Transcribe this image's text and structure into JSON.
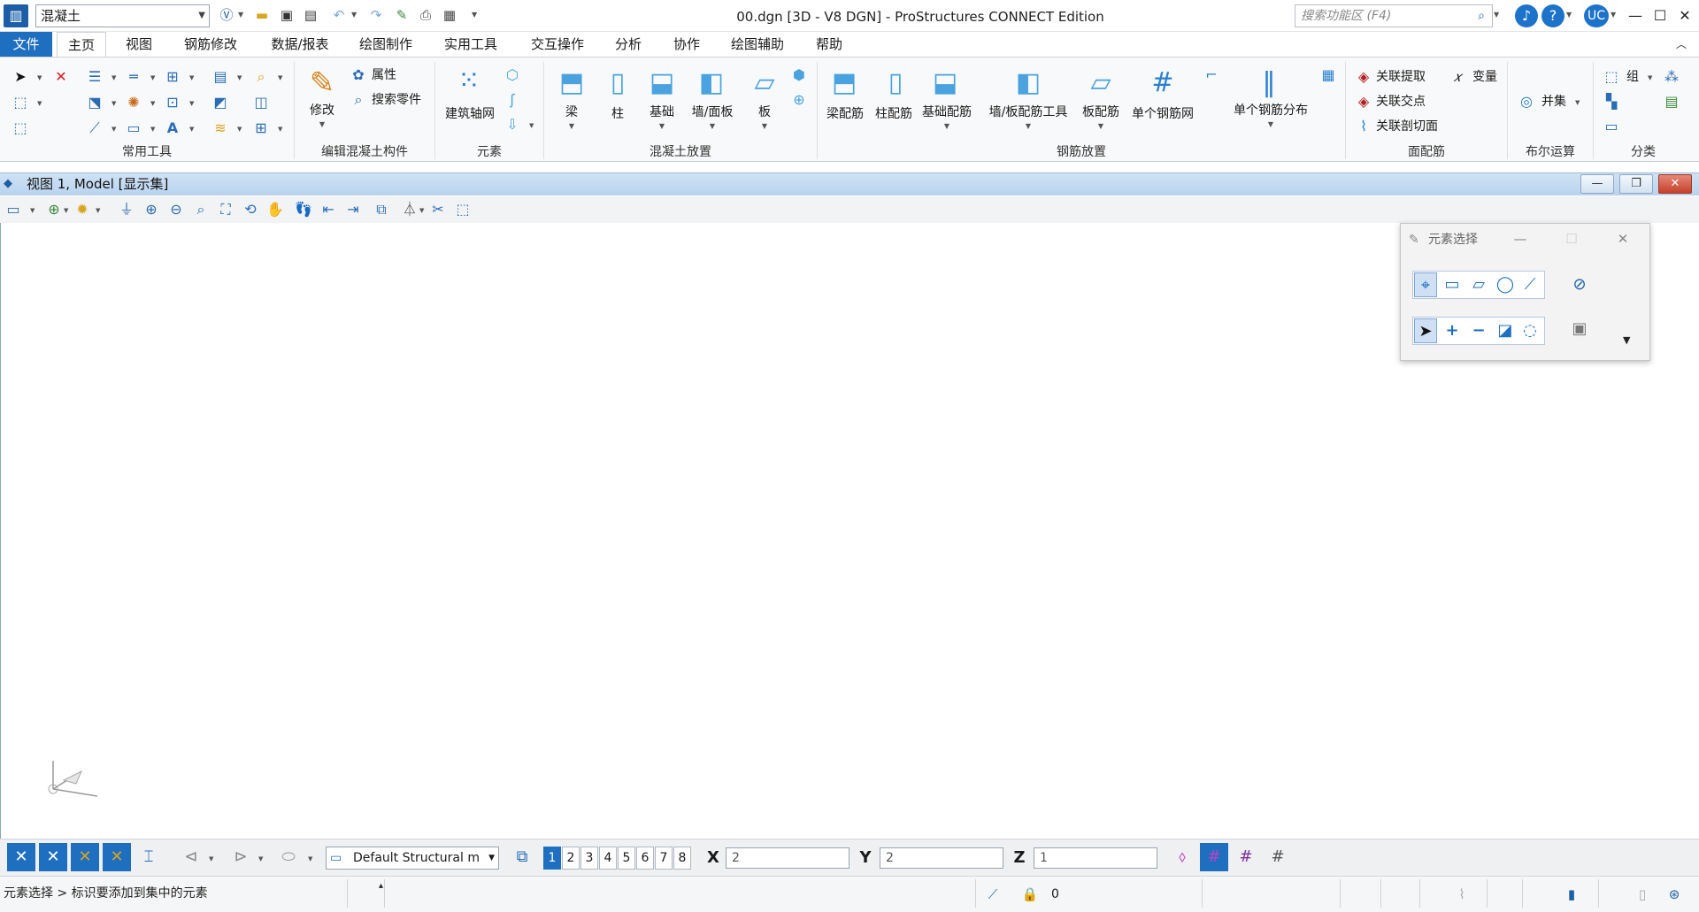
{
  "titlebar": {
    "workflow": "混凝土",
    "document_title": "00.dgn [3D - V8 DGN] - ProStructures CONNECT Edition",
    "search_placeholder": "搜索功能区 (F4)",
    "user_initials": "UC"
  },
  "menu_tabs": [
    {
      "label": "文件"
    },
    {
      "label": "主页"
    },
    {
      "label": "视图"
    },
    {
      "label": "钢筋修改"
    },
    {
      "label": "数据/报表"
    },
    {
      "label": "绘图制作"
    },
    {
      "label": "实用工具"
    },
    {
      "label": "交互操作"
    },
    {
      "label": "分析"
    },
    {
      "label": "协作"
    },
    {
      "label": "绘图辅助"
    },
    {
      "label": "帮助"
    }
  ],
  "ribbon": {
    "groups": {
      "common_tools": "常用工具",
      "edit_concrete": "编辑混凝土构件",
      "elements": "元素",
      "concrete_placement": "混凝土放置",
      "rebar_placement": "钢筋放置",
      "surface_rebar": "面配筋",
      "boolean": "布尔运算",
      "classify": "分类"
    },
    "buttons": {
      "modify": "修改",
      "properties": "属性",
      "search_parts": "搜索零件",
      "grid": "建筑轴网",
      "beam": "梁",
      "column": "柱",
      "foundation": "基础",
      "wall_panel": "墙/面板",
      "slab": "板",
      "beam_rebar": "梁配筋",
      "column_rebar": "柱配筋",
      "foundation_rebar": "基础配筋",
      "wall_slab_rebar_tool": "墙/板配筋工具",
      "slab_rebar": "板配筋",
      "single_mesh": "单个钢筋网",
      "single_distribution": "单个钢筋分布",
      "assoc_extract": "关联提取",
      "variable": "变量",
      "assoc_intersection": "关联交点",
      "assoc_section": "关联剖切面",
      "union": "并集",
      "group": "组"
    }
  },
  "view": {
    "title": "视图 1, Model [显示集]"
  },
  "element_selection": {
    "title": "元素选择"
  },
  "bottom": {
    "model": "Default Structural m",
    "view_numbers": [
      "1",
      "2",
      "3",
      "4",
      "5",
      "6",
      "7",
      "8"
    ],
    "x_label": "X",
    "x_value": "2",
    "y_label": "Y",
    "y_value": "2",
    "z_label": "Z",
    "z_value": "1"
  },
  "status": {
    "prompt": "元素选择 > 标识要添加到集中的元素",
    "active_level": "0"
  },
  "colors": {
    "accent": "#1f6fc0",
    "ribbon_bg": "#f8f9fa",
    "view_bar": "#c5dbf2"
  }
}
